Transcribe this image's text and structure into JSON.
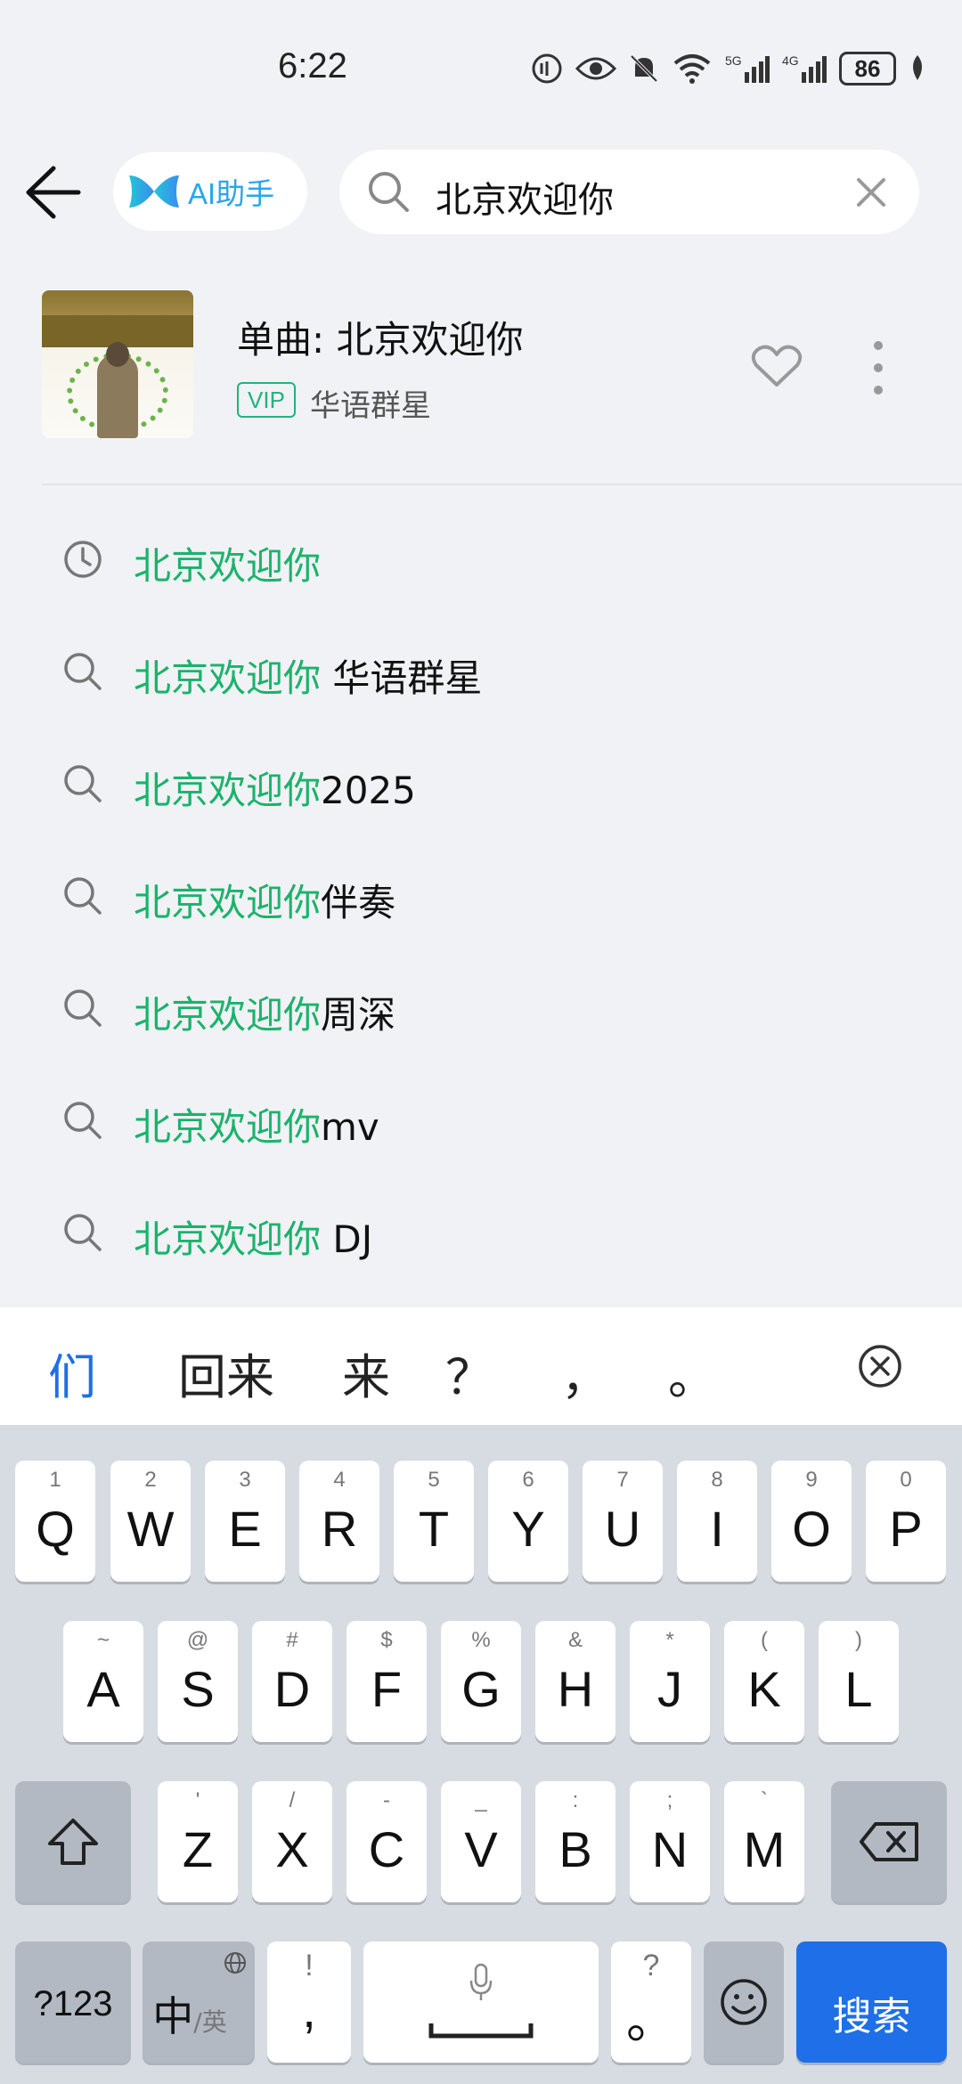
{
  "status_bar": {
    "time": "6:22",
    "battery": "86"
  },
  "header": {
    "ai_label": "AI助手",
    "search_value": "北京欢迎你"
  },
  "song": {
    "title": "单曲: 北京欢迎你",
    "badge": "VIP",
    "artist": "华语群星"
  },
  "suggestions": [
    {
      "icon": "history-icon",
      "highlight": "北京欢迎你",
      "rest": ""
    },
    {
      "icon": "search-icon",
      "highlight": "北京欢迎你",
      "rest": " 华语群星"
    },
    {
      "icon": "search-icon",
      "highlight": "北京欢迎你",
      "rest": "2025"
    },
    {
      "icon": "search-icon",
      "highlight": "北京欢迎你",
      "rest": "伴奏"
    },
    {
      "icon": "search-icon",
      "highlight": "北京欢迎你",
      "rest": "周深"
    },
    {
      "icon": "search-icon",
      "highlight": "北京欢迎你",
      "rest": "mv"
    },
    {
      "icon": "search-icon",
      "highlight": "北京欢迎你",
      "rest": " DJ"
    }
  ],
  "keyboard": {
    "candidates": [
      "们",
      "回来",
      "来",
      "？",
      "，",
      "。"
    ],
    "row1": [
      {
        "num": "1",
        "key": "Q"
      },
      {
        "num": "2",
        "key": "W"
      },
      {
        "num": "3",
        "key": "E"
      },
      {
        "num": "4",
        "key": "R"
      },
      {
        "num": "5",
        "key": "T"
      },
      {
        "num": "6",
        "key": "Y"
      },
      {
        "num": "7",
        "key": "U"
      },
      {
        "num": "8",
        "key": "I"
      },
      {
        "num": "9",
        "key": "O"
      },
      {
        "num": "0",
        "key": "P"
      }
    ],
    "row2": [
      {
        "num": "~",
        "key": "A"
      },
      {
        "num": "@",
        "key": "S"
      },
      {
        "num": "#",
        "key": "D"
      },
      {
        "num": "$",
        "key": "F"
      },
      {
        "num": "%",
        "key": "G"
      },
      {
        "num": "&",
        "key": "H"
      },
      {
        "num": "*",
        "key": "J"
      },
      {
        "num": "(",
        "key": "K"
      },
      {
        "num": ")",
        "key": "L"
      }
    ],
    "row3": [
      {
        "num": "'",
        "key": "Z"
      },
      {
        "num": "/",
        "key": "X"
      },
      {
        "num": "-",
        "key": "C"
      },
      {
        "num": "_",
        "key": "V"
      },
      {
        "num": ":",
        "key": "B"
      },
      {
        "num": ";",
        "key": "N"
      },
      {
        "num": "`",
        "key": "M"
      }
    ],
    "numbers_key": "?123",
    "lang_key": "中",
    "lang_sub": "/英",
    "comma_top": "!",
    "comma_key": ",",
    "period_top": "?",
    "period_key": "。",
    "search_key": "搜索"
  },
  "colors": {
    "highlight": "#1ab36b",
    "accent_blue": "#1e6fe8",
    "vip_green": "#20b47c"
  }
}
